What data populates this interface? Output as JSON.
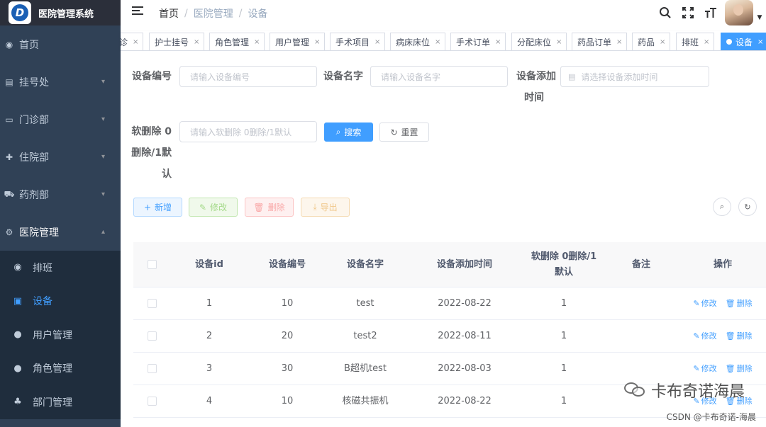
{
  "app": {
    "title": "医院管理系统",
    "logo_letter": "D"
  },
  "sidebar": {
    "items": [
      {
        "label": "首页",
        "icon": "dashboard-icon",
        "glyph": "◉",
        "has_arrow": false
      },
      {
        "label": "挂号处",
        "icon": "register-icon",
        "glyph": "▤",
        "has_arrow": true
      },
      {
        "label": "门诊部",
        "icon": "outpatient-icon",
        "glyph": "▭",
        "has_arrow": true
      },
      {
        "label": "住院部",
        "icon": "inpatient-icon",
        "glyph": "✚",
        "has_arrow": true
      },
      {
        "label": "药剂部",
        "icon": "cart-icon",
        "glyph": "⛟",
        "has_arrow": true
      },
      {
        "label": "医院管理",
        "icon": "gear-icon",
        "glyph": "⚙",
        "has_arrow": true
      }
    ],
    "submenu": [
      {
        "label": "排班",
        "icon": "eye-icon",
        "glyph": "◉"
      },
      {
        "label": "设备",
        "icon": "monitor-icon",
        "glyph": "▣",
        "active": true
      },
      {
        "label": "用户管理",
        "icon": "user-icon",
        "glyph": "●"
      },
      {
        "label": "角色管理",
        "icon": "people-icon",
        "glyph": "●"
      },
      {
        "label": "部门管理",
        "icon": "tree-icon",
        "glyph": "♣"
      }
    ]
  },
  "breadcrumb": [
    "首页",
    "医院管理",
    "设备"
  ],
  "tags": [
    {
      "label": "诊",
      "active": false
    },
    {
      "label": "护士挂号",
      "active": false
    },
    {
      "label": "角色管理",
      "active": false
    },
    {
      "label": "用户管理",
      "active": false
    },
    {
      "label": "手术项目",
      "active": false
    },
    {
      "label": "病床床位",
      "active": false
    },
    {
      "label": "手术订单",
      "active": false
    },
    {
      "label": "分配床位",
      "active": false
    },
    {
      "label": "药品订单",
      "active": false
    },
    {
      "label": "药品",
      "active": false
    },
    {
      "label": "排班",
      "active": false
    },
    {
      "label": "设备",
      "active": true
    }
  ],
  "search": {
    "code_label": "设备编号",
    "code_placeholder": "请输入设备编号",
    "name_label": "设备名字",
    "name_placeholder": "请输入设备名字",
    "time_label_1": "设备添加",
    "time_label_2": "时间",
    "time_placeholder": "请选择设备添加时间",
    "del_label_1": "软删除 0",
    "del_label_2": "删除/1默",
    "del_label_3": "认",
    "del_placeholder": "请输入软删除 0删除/1默认",
    "search_btn": "搜索",
    "reset_btn": "重置"
  },
  "toolbar": {
    "add": "新增",
    "edit": "修改",
    "delete": "删除",
    "export": "导出"
  },
  "table": {
    "headers": [
      "设备id",
      "设备编号",
      "设备名字",
      "设备添加时间",
      "软删除 0删除/1默认",
      "备注",
      "操作"
    ],
    "header_del_1": "软删除 0删除/1",
    "header_del_2": "默认",
    "rows": [
      {
        "id": "1",
        "code": "10",
        "name": "test",
        "time": "2022-08-22",
        "del": "1",
        "remark": ""
      },
      {
        "id": "2",
        "code": "20",
        "name": "test2",
        "time": "2022-08-11",
        "del": "1",
        "remark": ""
      },
      {
        "id": "3",
        "code": "30",
        "name": "B超机test",
        "time": "2022-08-03",
        "del": "1",
        "remark": ""
      },
      {
        "id": "4",
        "code": "10",
        "name": "核磁共振机",
        "time": "2022-08-22",
        "del": "1",
        "remark": ""
      }
    ],
    "op_edit": "修改",
    "op_delete": "删除"
  },
  "watermark": {
    "text": "卡布奇诺海晨",
    "csdn": "CSDN @卡布奇诺-海晨"
  }
}
